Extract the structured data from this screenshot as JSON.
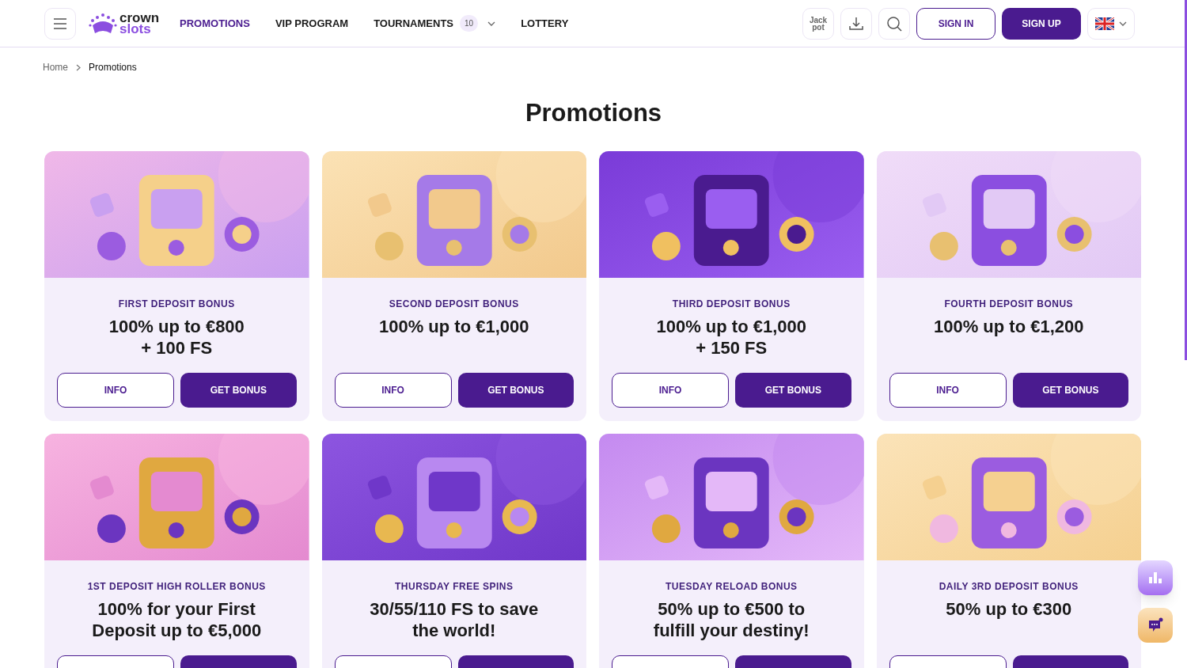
{
  "header": {
    "logo": {
      "top": "crown",
      "bottom": "slots"
    },
    "nav": [
      {
        "label": "PROMOTIONS",
        "selected": true
      },
      {
        "label": "VIP PROGRAM",
        "selected": false
      },
      {
        "label": "TOURNAMENTS",
        "selected": false,
        "badge": "10",
        "dropdown": true
      },
      {
        "label": "LOTTERY",
        "selected": false
      }
    ],
    "jackpot": {
      "top": "Jack",
      "bottom": "pot"
    },
    "sign_in": "SIGN IN",
    "sign_up": "SIGN UP"
  },
  "breadcrumb": [
    {
      "label": "Home"
    },
    {
      "label": "Promotions"
    }
  ],
  "title": "Promotions",
  "promotions": [
    {
      "category": "FIRST DEPOSIT BONUS",
      "offer": "100% up to €800\n+ 100 FS",
      "actions": [
        {
          "kind": "info",
          "label": "INFO"
        },
        {
          "kind": "get",
          "label": "GET BONUS"
        }
      ]
    },
    {
      "category": "SECOND DEPOSIT BONUS",
      "offer": "100% up to €1,000",
      "actions": [
        {
          "kind": "info",
          "label": "INFO"
        },
        {
          "kind": "get",
          "label": "GET BONUS"
        }
      ]
    },
    {
      "category": "THIRD DEPOSIT BONUS",
      "offer": "100% up to €1,000\n+ 150 FS",
      "actions": [
        {
          "kind": "info",
          "label": "INFO"
        },
        {
          "kind": "get",
          "label": "GET BONUS"
        }
      ]
    },
    {
      "category": "FOURTH DEPOSIT BONUS",
      "offer": "100% up to €1,200",
      "actions": [
        {
          "kind": "info",
          "label": "INFO"
        },
        {
          "kind": "get",
          "label": "GET BONUS"
        }
      ]
    },
    {
      "category": "1ST DEPOSIT HIGH ROLLER BONUS",
      "offer": "100% for your First\nDeposit up to €5,000",
      "actions": [
        {
          "kind": "info"
        },
        {
          "kind": "get"
        }
      ]
    },
    {
      "category": "THURSDAY FREE SPINS",
      "offer": "30/55/110 FS to save\nthe world!",
      "actions": [
        {
          "kind": "info"
        },
        {
          "kind": "get"
        }
      ]
    },
    {
      "category": "TUESDAY RELOAD BONUS",
      "offer": "50% up to €500 to\nfulfill your destiny!",
      "actions": [
        {
          "kind": "info"
        },
        {
          "kind": "get"
        }
      ]
    },
    {
      "category": "DAILY 3RD DEPOSIT BONUS",
      "offer": "50% up to €300",
      "actions": [
        {
          "kind": "info"
        },
        {
          "kind": "get"
        }
      ]
    }
  ]
}
